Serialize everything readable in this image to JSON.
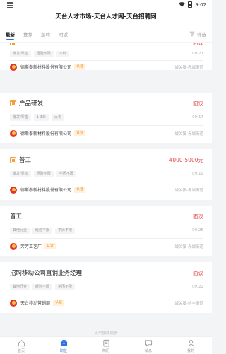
{
  "status": {
    "time": "9:02"
  },
  "header": {
    "title": "天台人才市场-天台人才网-天台招聘网"
  },
  "tabs": [
    {
      "label": "最新",
      "active": true
    },
    {
      "label": "推荐",
      "active": false
    },
    {
      "label": "急聘",
      "active": false
    },
    {
      "label": "附近",
      "active": false
    }
  ],
  "filter": {
    "label": "筛选"
  },
  "jobs": [
    {
      "title": "",
      "salary": "面议",
      "tags": [
        "批发/零售",
        "经验不限",
        "本科"
      ],
      "time": "09:27",
      "company": "德斯泰新材料股份有限公司",
      "certified": "认证",
      "location": "城关镇-赤城街道"
    },
    {
      "title": "产品研发",
      "salary": "面议",
      "tags": [
        "批发/零售",
        "1-3年",
        "大专"
      ],
      "time": "09:17",
      "company": "德斯泰新材料股份有限公司",
      "certified": "认证",
      "location": "城关镇-赤城街道"
    },
    {
      "title": "普工",
      "salary": "4000-5000元",
      "tags": [
        "批发/零售",
        "经验不限",
        "学历不限"
      ],
      "time": "09:19",
      "company": "德斯泰新材料股份有限公司",
      "certified": "认证",
      "location": "城关镇-赤城街道"
    },
    {
      "title": "普工",
      "salary": "面议",
      "tags": [
        "其他行业",
        "经验不限",
        "学历不限"
      ],
      "time": "09:25",
      "company": "芳芳工艺厂",
      "certified": "认证",
      "location": "城关镇-赤城街道"
    },
    {
      "title": "招聘移动公司直销业务经理",
      "salary": "面议",
      "tags": [
        "其他行业",
        "经验不限",
        "学历不限"
      ],
      "time": "09:22",
      "company": "天台移动营销部",
      "certified": "认证",
      "location": "城关镇-始丰街道"
    }
  ],
  "load_more": "点击加载更多",
  "bottom_nav": [
    {
      "label": "首页",
      "icon": "home-icon",
      "active": false
    },
    {
      "label": "职位",
      "icon": "briefcase-icon",
      "active": true
    },
    {
      "label": "简历",
      "icon": "resume-icon",
      "active": false
    },
    {
      "label": "消息",
      "icon": "message-icon",
      "active": false
    },
    {
      "label": "我的",
      "icon": "profile-icon",
      "active": false
    }
  ],
  "colors": {
    "accent": "#2f6fe0",
    "salary": "#e34d4d",
    "cert": "#ef8c1f"
  }
}
